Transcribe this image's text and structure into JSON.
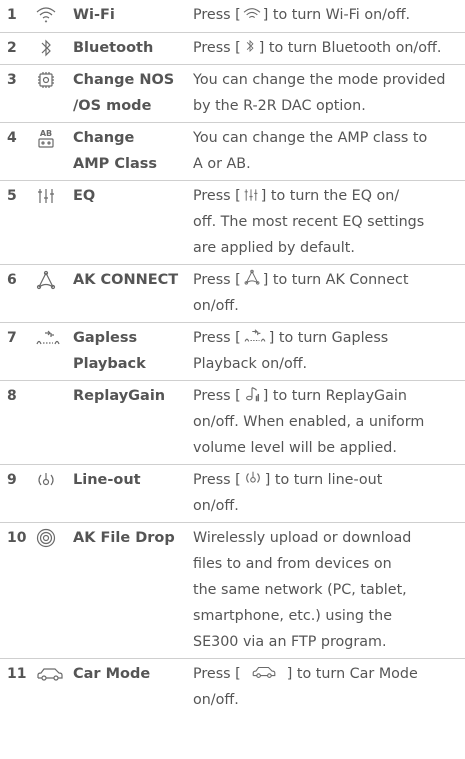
{
  "rows": [
    {
      "num": "1",
      "name": "Wi-Fi",
      "d_pre": "Press [",
      "d_post": "] to turn Wi-Fi on/off."
    },
    {
      "num": "2",
      "name": "Bluetooth",
      "d_pre": "Press [",
      "d_post": "] to turn Bluetooth on/off."
    },
    {
      "num": "3",
      "name_1": "Change NOS",
      "name_2": "/OS mode",
      "d_1": "You can change the mode provided",
      "d_2": "by the R-2R DAC option."
    },
    {
      "num": "4",
      "icon_text": "AB",
      "name_1": "Change",
      "name_2": "AMP Class",
      "d_1": "You can change the AMP class to",
      "d_2": "A or AB."
    },
    {
      "num": "5",
      "name": "EQ",
      "d_pre": "Press [",
      "d_post": "] to turn the EQ on/",
      "d_2": "off. The most recent EQ settings",
      "d_3": "are applied by default."
    },
    {
      "num": "6",
      "name": "AK CONNECT",
      "d_pre": "Press [",
      "d_post": "] to turn AK Connect",
      "d_2": "on/off."
    },
    {
      "num": "7",
      "name_1": "Gapless",
      "name_2": "Playback",
      "d_pre": "Press [",
      "d_post": "] to turn Gapless",
      "d_2": "Playback on/off."
    },
    {
      "num": "8",
      "name": "ReplayGain",
      "d_pre": "Press [",
      "d_post": "] to turn ReplayGain",
      "d_2": "on/off. When enabled, a uniform",
      "d_3": "volume level will be applied."
    },
    {
      "num": "9",
      "name": "Line-out",
      "d_pre": "Press [",
      "d_post": "] to turn line-out",
      "d_2": "on/off."
    },
    {
      "num": "10",
      "name": "AK File Drop",
      "d_1": "Wirelessly upload or download",
      "d_2": "files to and from devices on",
      "d_3": "the same network (PC, tablet,",
      "d_4": "smartphone, etc.) using the",
      "d_5": "SE300 via an FTP program."
    },
    {
      "num": "11",
      "name": "Car Mode",
      "d_pre": "Press [",
      "d_post": "] to turn Car Mode",
      "d_2": "on/off."
    }
  ],
  "icons": [
    "wifi-icon",
    "bluetooth-icon",
    "chip-icon",
    "amp-class-icon",
    "eq-sliders-icon",
    "ak-connect-icon",
    "gapless-icon",
    "replaygain-icon",
    "line-out-icon",
    "file-drop-icon",
    "car-icon"
  ]
}
